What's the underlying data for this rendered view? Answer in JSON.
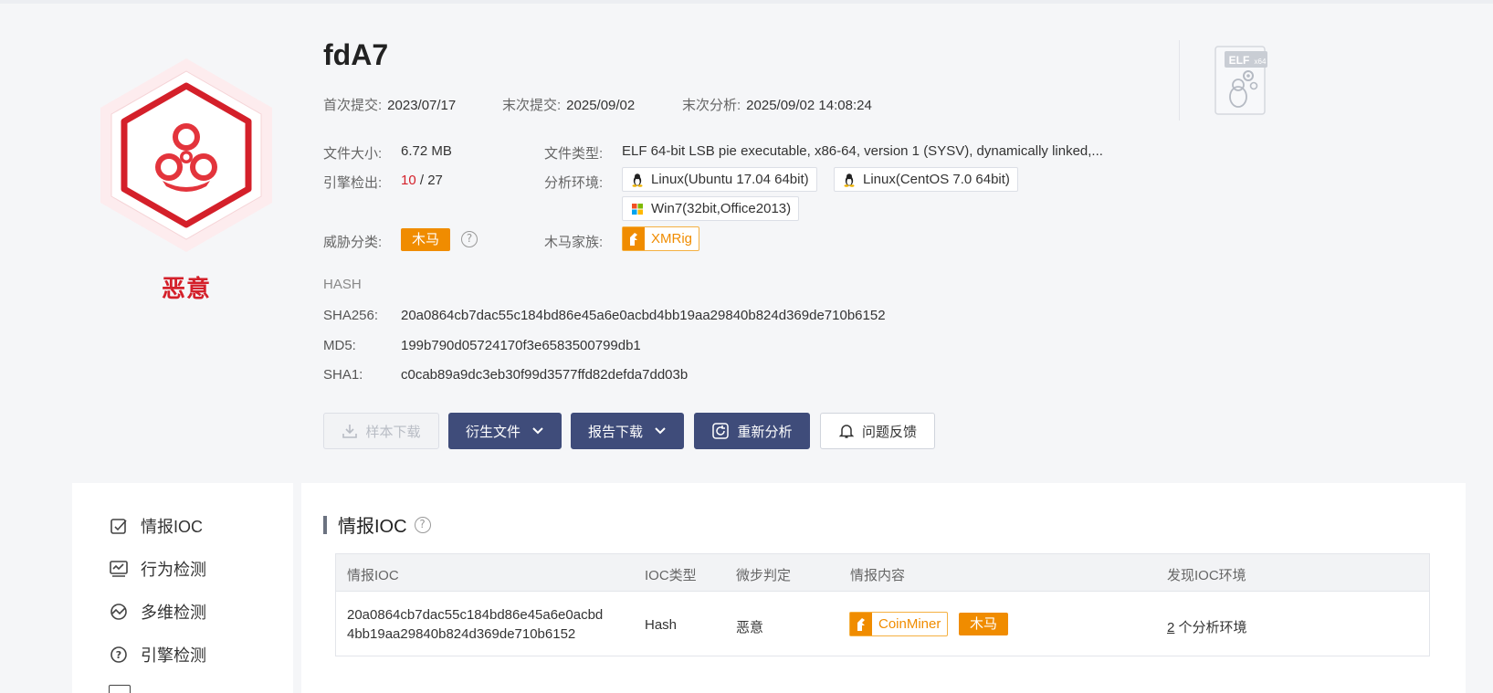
{
  "file": {
    "name": "fdA7",
    "verdict": "恶意",
    "first_submit_label": "首次提交:",
    "first_submit": "2023/07/17",
    "last_submit_label": "末次提交:",
    "last_submit": "2025/09/02",
    "last_analysis_label": "末次分析:",
    "last_analysis": "2025/09/02 14:08:24",
    "size_label": "文件大小:",
    "size": "6.72 MB",
    "type_label": "文件类型:",
    "type": "ELF 64-bit LSB pie executable, x86-64, version 1 (SYSV), dynamically linked,...",
    "engine_label": "引擎检出:",
    "engine_hits": "10",
    "engine_total": "/ 27",
    "env_label": "分析环境:",
    "envs": [
      "Linux(Ubuntu 17.04 64bit)",
      "Linux(CentOS 7.0 64bit)",
      "Win7(32bit,Office2013)"
    ],
    "threat_label": "威胁分类:",
    "threat_class": "木马",
    "family_label": "木马家族:",
    "family": "XMRig",
    "elf_badge": "ELF",
    "elf_arch": "x64"
  },
  "hash": {
    "title": "HASH",
    "sha256_label": "SHA256:",
    "sha256": "20a0864cb7dac55c184bd86e45a6e0acbd4bb19aa29840b824d369de710b6152",
    "md5_label": "MD5:",
    "md5": "199b790d05724170f3e6583500799db1",
    "sha1_label": "SHA1:",
    "sha1": "c0cab89a9dc3eb30f99d3577ffd82defda7dd03b"
  },
  "actions": {
    "download": "样本下载",
    "derived": "衍生文件",
    "report": "报告下载",
    "reanalyze": "重新分析",
    "feedback": "问题反馈"
  },
  "sidebar": {
    "items": [
      "情报IOC",
      "行为检测",
      "多维检测",
      "引擎检测"
    ]
  },
  "ioc": {
    "title": "情报IOC",
    "columns": [
      "情报IOC",
      "IOC类型",
      "微步判定",
      "情报内容",
      "发现IOC环境"
    ],
    "row": {
      "ioc_line1": "20a0864cb7dac55c184bd86e45a6e0acbd",
      "ioc_line2": "4bb19aa29840b824d369de710b6152",
      "type": "Hash",
      "verdict": "恶意",
      "content_family": "CoinMiner",
      "content_tag": "木马",
      "env_count": "2",
      "env_suffix": "个分析环境"
    }
  },
  "colors": {
    "malicious_red": "#d4202a",
    "trojan_orange": "#f08c00",
    "button_navy": "#3f4c7a"
  }
}
